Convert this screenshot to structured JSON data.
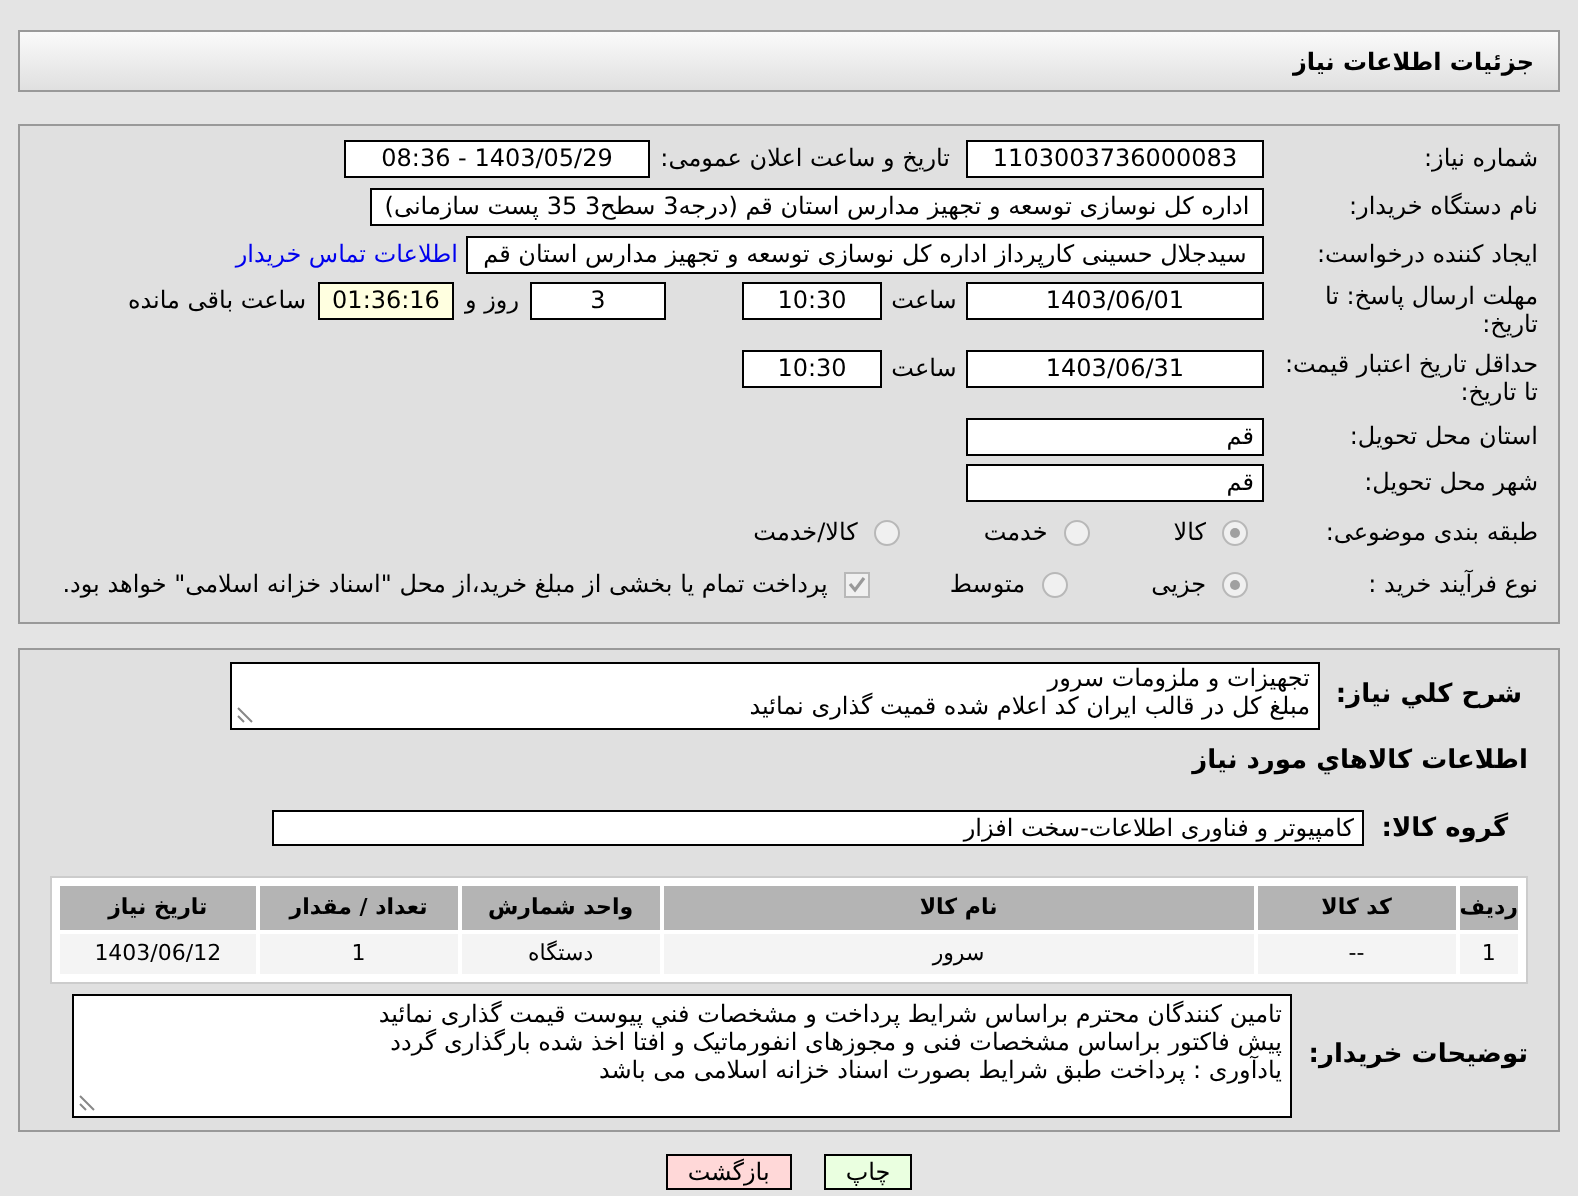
{
  "header": {
    "title": "جزئیات اطلاعات نیاز"
  },
  "need_number": {
    "label": "شماره نیاز:",
    "value": "1103003736000083"
  },
  "announce": {
    "label": "تاریخ و ساعت اعلان عمومی:",
    "value": "1403/05/29 - 08:36"
  },
  "buyer_org": {
    "label": "نام دستگاه خریدار:",
    "value": "اداره کل نوسازی   توسعه و تجهیز مدارس استان قم (درجه3 سطح3  35 پست سازمانی)"
  },
  "requester": {
    "label": "ایجاد کننده درخواست:",
    "value": "سیدجلال حسینی کارپرداز اداره کل نوسازی   توسعه و تجهیز مدارس استان قم",
    "link": "اطلاعات تماس خریدار"
  },
  "response_deadline": {
    "label": "مهلت ارسال پاسخ: تا تاریخ:",
    "date": "1403/06/01",
    "time_label": "ساعت",
    "time": "10:30",
    "days": "3",
    "days_label": "روز و",
    "remaining": "01:36:16",
    "remaining_label": "ساعت باقی مانده"
  },
  "price_validity": {
    "label": "حداقل تاریخ اعتبار قیمت: تا تاریخ:",
    "date": "1403/06/31",
    "time_label": "ساعت",
    "time": "10:30"
  },
  "province": {
    "label": "استان محل تحویل:",
    "value": "قم"
  },
  "city": {
    "label": "شهر محل تحویل:",
    "value": "قم"
  },
  "category": {
    "label": "طبقه بندی موضوعی:",
    "options": [
      {
        "label": "کالا",
        "selected": true
      },
      {
        "label": "خدمت",
        "selected": false
      },
      {
        "label": "کالا/خدمت",
        "selected": false
      }
    ]
  },
  "process": {
    "label": "نوع فرآیند خرید :",
    "options": [
      {
        "label": "جزیی",
        "selected": true
      },
      {
        "label": "متوسط",
        "selected": false
      }
    ],
    "treasury": {
      "label": "پرداخت تمام یا بخشی از مبلغ خرید،از محل \"اسناد خزانه اسلامی\" خواهد بود.",
      "checked": true
    }
  },
  "description": {
    "label": "شرح کلي نياز:",
    "lines": [
      "تجهیزات و ملزومات سرور",
      "مبلغ کل در قالب ایران کد اعلام شده قمیت گذاری نمائید"
    ]
  },
  "goods_heading": "اطلاعات کالاهاي مورد نياز",
  "goods_group": {
    "label": "گروه کالا:",
    "value": "کامپیوتر و فناوری اطلاعات-سخت افزار"
  },
  "table": {
    "columns": [
      "ردیف",
      "کد کالا",
      "نام کالا",
      "واحد شمارش",
      "تعداد / مقدار",
      "تاریخ نیاز"
    ],
    "rows": [
      [
        "1",
        "--",
        "سرور",
        "دستگاه",
        "1",
        "1403/06/12"
      ]
    ]
  },
  "buyer_notes": {
    "label": "توضیحات خریدار:",
    "lines": [
      "تامین کنندگان محترم براساس شرایط پرداخت و مشخصات فني پیوست قیمت گذاری نمائید",
      "پیش فاکتور براساس مشخصات فنی و مجوزهای انفورماتیک و افتا اخذ شده بارگذاری گردد",
      "یادآوری : پرداخت طبق شرایط بصورت اسناد خزانه اسلامی می باشد"
    ]
  },
  "buttons": [
    {
      "label": "چاپ",
      "kind": "print"
    },
    {
      "label": "بازگشت",
      "kind": "back"
    }
  ]
}
